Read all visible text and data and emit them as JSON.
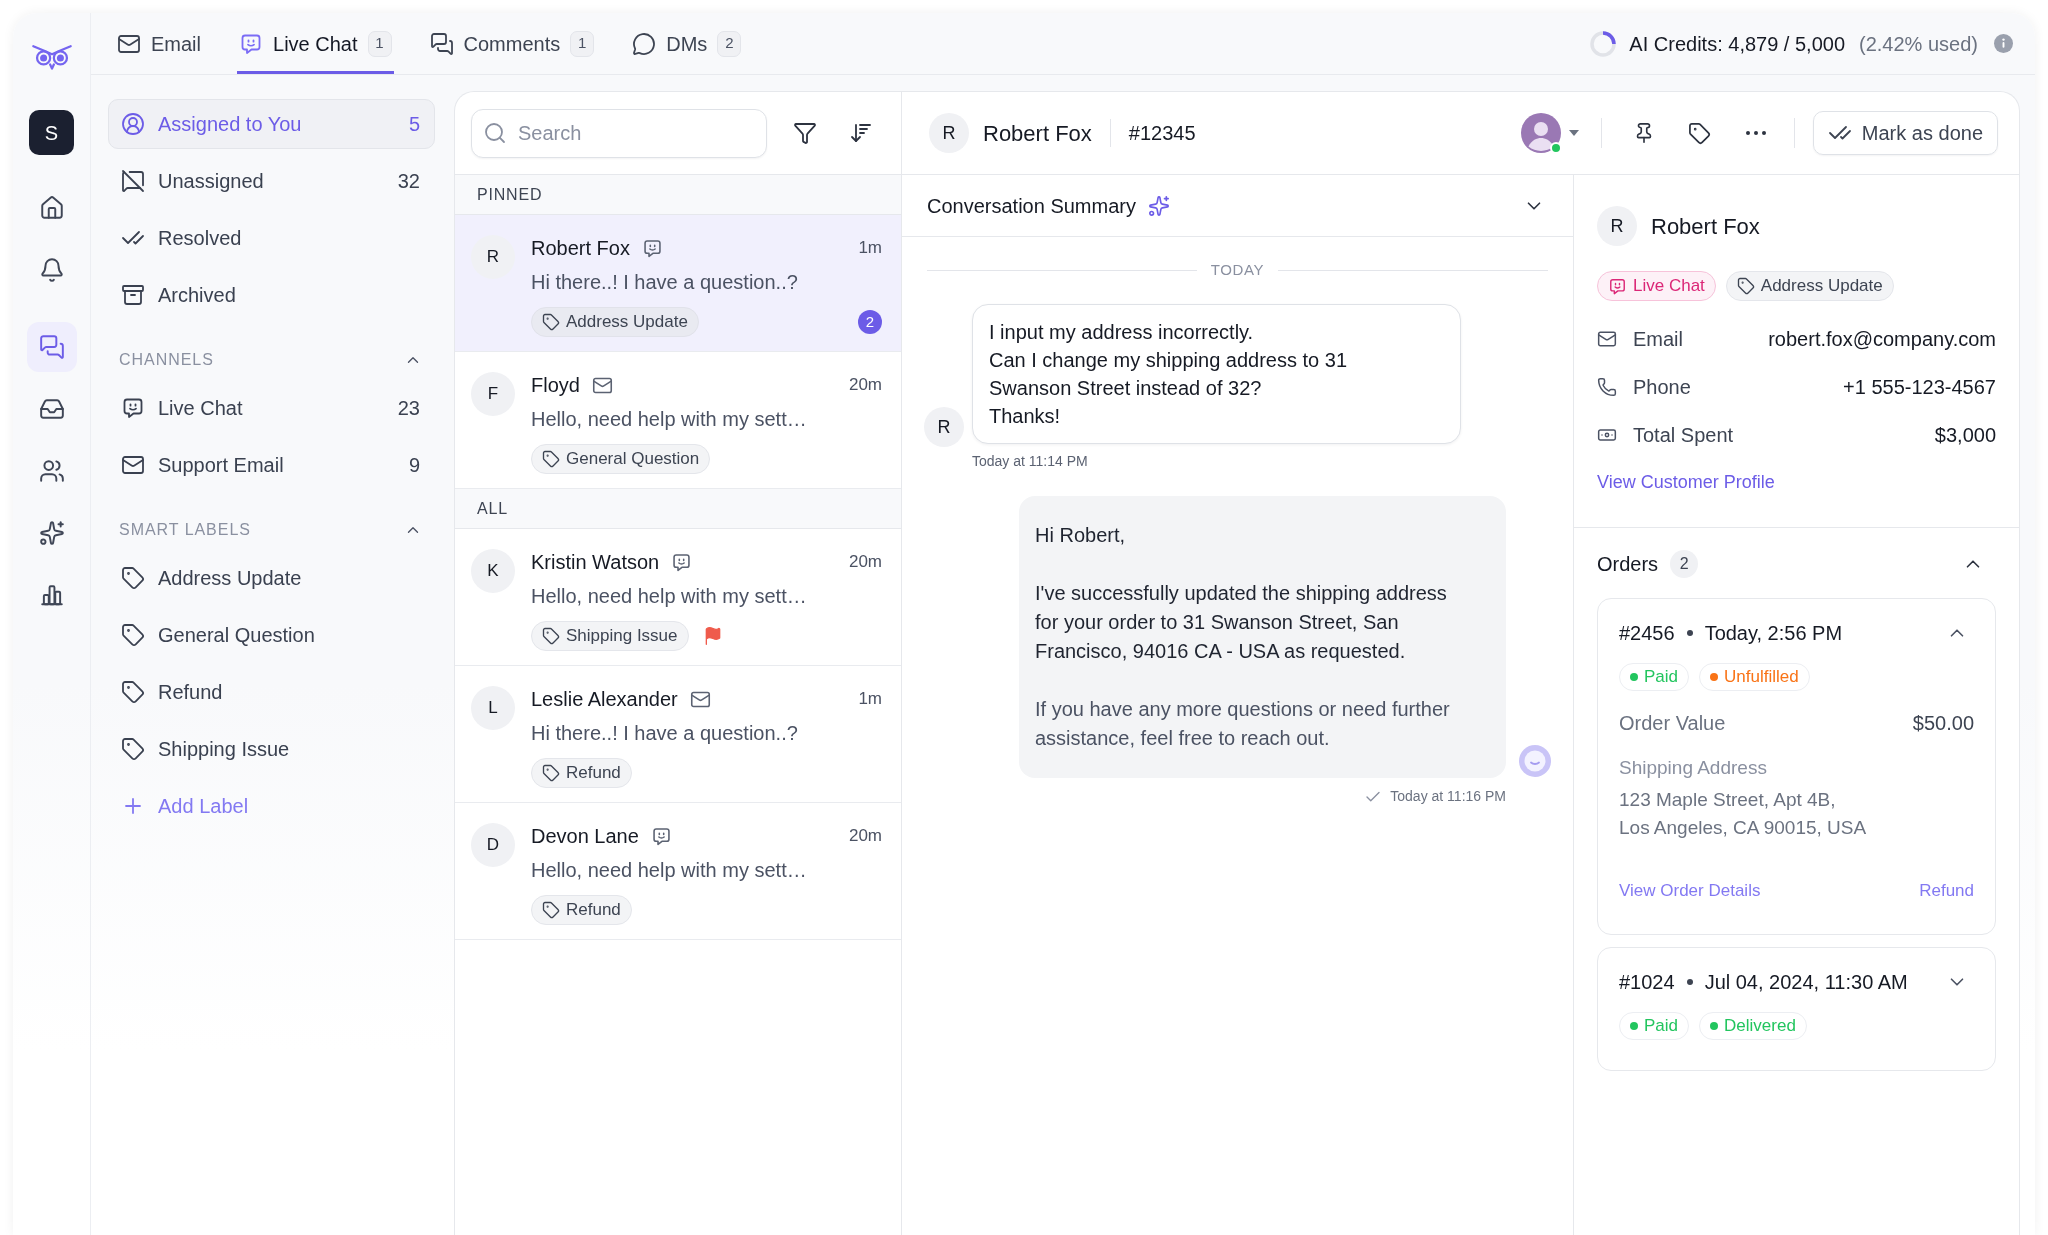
{
  "rail": {
    "user_initial": "S",
    "items": [
      {
        "selected": false
      },
      {
        "selected": false
      },
      {
        "selected": true
      },
      {
        "selected": false
      },
      {
        "selected": false
      },
      {
        "selected": false
      },
      {
        "selected": false
      }
    ]
  },
  "tabs": [
    {
      "label": "Email",
      "selected": false
    },
    {
      "label": "Live Chat",
      "count": "1",
      "selected": true
    },
    {
      "label": "Comments",
      "count": "1",
      "selected": false
    },
    {
      "label": "DMs",
      "count": "2",
      "selected": false
    }
  ],
  "ai_credits": {
    "label": "AI Credits: 4,879 / 5,000",
    "usage": "(2.42% used)"
  },
  "inbox_nav": {
    "items": [
      {
        "label": "Assigned to You",
        "count": "5",
        "selected": true
      },
      {
        "label": "Unassigned",
        "count": "32",
        "selected": false
      },
      {
        "label": "Resolved",
        "selected": false
      },
      {
        "label": "Archived",
        "selected": false
      }
    ],
    "sections": [
      {
        "title": "CHANNELS",
        "expanded": true,
        "items": [
          {
            "kind": "chat",
            "label": "Live Chat",
            "count": "23",
            "selected": false
          },
          {
            "kind": "email",
            "label": "Support Email",
            "count": "9",
            "selected": false
          }
        ]
      },
      {
        "title": "SMART LABELS",
        "expanded": true,
        "items": [
          {
            "kind": "label",
            "label": "Address Update",
            "selected": false
          },
          {
            "kind": "label",
            "label": "General Question",
            "selected": false
          },
          {
            "kind": "label",
            "label": "Refund",
            "selected": false
          },
          {
            "kind": "label",
            "label": "Shipping Issue",
            "selected": false
          }
        ]
      }
    ],
    "add_label": "Add Label"
  },
  "conversation_list": {
    "search": {
      "placeholder": "Search"
    },
    "groups": [
      {
        "title": "PINNED",
        "conversations": [
          {
            "initial": "R",
            "name": "Robert Fox",
            "kind": "chat",
            "time": "1m",
            "preview": "Hi there..! I have a question..?",
            "tag": "Address Update",
            "unread": "2",
            "flagged": false,
            "selected": true
          },
          {
            "initial": "F",
            "name": "Floyd",
            "kind": "email",
            "time": "20m",
            "preview": "Hello, need help with my sett…",
            "tag": "General Question",
            "flagged": false,
            "selected": false
          }
        ]
      },
      {
        "title": "ALL",
        "conversations": [
          {
            "initial": "K",
            "name": "Kristin Watson",
            "kind": "chat",
            "time": "20m",
            "preview": "Hello, need help with my sett…",
            "tag": "Shipping Issue",
            "flagged": true,
            "selected": false
          },
          {
            "initial": "L",
            "name": "Leslie Alexander",
            "kind": "email",
            "time": "1m",
            "preview": "Hi there..! I have a question..?",
            "tag": "Refund",
            "flagged": false,
            "selected": false
          },
          {
            "initial": "D",
            "name": "Devon Lane",
            "kind": "chat",
            "time": "20m",
            "preview": "Hello, need help with my sett…",
            "tag": "Refund",
            "flagged": false,
            "selected": false
          }
        ]
      }
    ]
  },
  "conversation": {
    "contact": {
      "initial": "R",
      "name": "Robert Fox",
      "ticket": "#12345"
    },
    "assignee": {
      "online": true
    },
    "done_button": "Mark as done",
    "summary": {
      "title": "Conversation Summary",
      "expanded": false
    },
    "day": "TODAY",
    "messages": [
      {
        "kind": "customer",
        "initial": "R",
        "paragraphs": [
          "I input my address incorrectly.",
          "Can I change my shipping address to 31 Swanson Street instead of 32?",
          "Thanks!"
        ],
        "time": "Today at 11:14 PM"
      },
      {
        "kind": "agent",
        "paragraphs": [
          "Hi Robert,",
          "I've successfully updated the shipping address for your order to 31 Swanson Street, San Francisco, 94016 CA - USA as requested.",
          "If you have any more questions or need further assistance, feel free to reach out."
        ],
        "time": "Today at 11:16 PM"
      }
    ]
  },
  "customer": {
    "initial": "R",
    "name": "Robert Fox",
    "tags": [
      {
        "kind": "channel",
        "label": "Live Chat"
      },
      {
        "kind": "label",
        "label": "Address Update"
      }
    ],
    "fields": [
      {
        "label": "Email",
        "value": "robert.fox@company.com"
      },
      {
        "label": "Phone",
        "value": "+1 555-123-4567"
      },
      {
        "label": "Total Spent",
        "value": "$3,000"
      }
    ],
    "profile_link": "View Customer Profile"
  },
  "orders": {
    "title": "Orders",
    "count": "2",
    "expanded": true,
    "items": [
      {
        "number": "#2456",
        "date": "Today, 2:56 PM",
        "expanded": true,
        "statuses": [
          {
            "label": "Paid",
            "color": "#22c55e"
          },
          {
            "label": "Unfulfilled",
            "color": "#f97316"
          }
        ],
        "value_label": "Order Value",
        "value": "$50.00",
        "address_label": "Shipping Address",
        "address_lines": [
          "123 Maple Street, Apt 4B,",
          "Los Angeles, CA 90015, USA"
        ],
        "links": [
          "View Order Details",
          "Refund"
        ]
      },
      {
        "number": "#1024",
        "date": "Jul 04, 2024, 11:30 AM",
        "expanded": false,
        "statuses": [
          {
            "label": "Paid",
            "color": "#22c55e"
          },
          {
            "label": "Delivered",
            "color": "#22c55e"
          }
        ]
      }
    ]
  }
}
